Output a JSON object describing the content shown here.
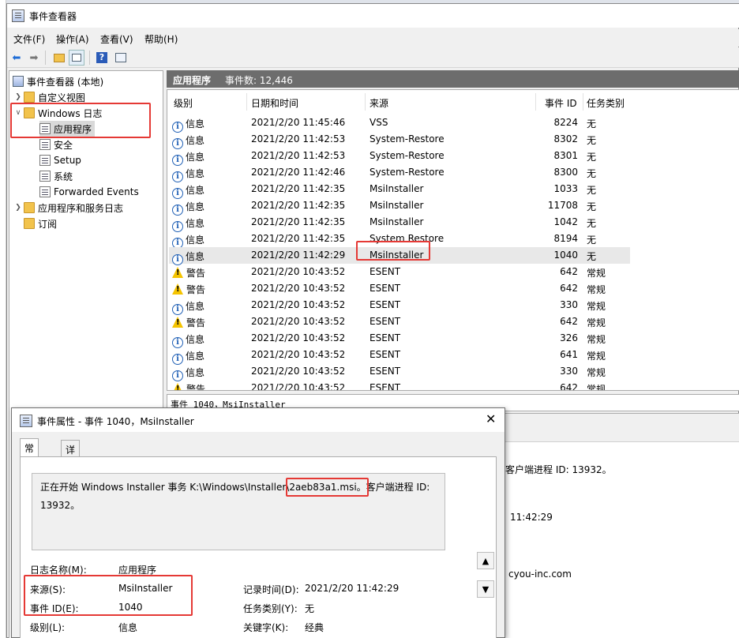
{
  "window": {
    "title": "事件查看器"
  },
  "menu": [
    "文件(F)",
    "操作(A)",
    "查看(V)",
    "帮助(H)"
  ],
  "toolbar_icons": [
    "back-arrow-icon",
    "forward-arrow-icon",
    "folder-up-icon",
    "show-hide-tree-icon",
    "help-icon",
    "properties-icon"
  ],
  "tree": {
    "root": "事件查看器 (本地)",
    "custom_views": "自定义视图",
    "windows_logs": "Windows 日志",
    "children": [
      "应用程序",
      "安全",
      "Setup",
      "系统",
      "Forwarded Events"
    ],
    "app_service_logs": "应用程序和服务日志",
    "subscriptions": "订阅"
  },
  "panel": {
    "title": "应用程序",
    "count": "事件数: 12,446"
  },
  "columns": [
    "级别",
    "日期和时间",
    "来源",
    "事件 ID",
    "任务类别"
  ],
  "rows": [
    {
      "level": "信息",
      "type": "info",
      "time": "2021/2/20 11:45:46",
      "source": "VSS",
      "id": "8224",
      "cat": "无"
    },
    {
      "level": "信息",
      "type": "info",
      "time": "2021/2/20 11:42:53",
      "source": "System-Restore",
      "id": "8302",
      "cat": "无"
    },
    {
      "level": "信息",
      "type": "info",
      "time": "2021/2/20 11:42:53",
      "source": "System-Restore",
      "id": "8301",
      "cat": "无"
    },
    {
      "level": "信息",
      "type": "info",
      "time": "2021/2/20 11:42:46",
      "source": "System-Restore",
      "id": "8300",
      "cat": "无"
    },
    {
      "level": "信息",
      "type": "info",
      "time": "2021/2/20 11:42:35",
      "source": "MsiInstaller",
      "id": "1033",
      "cat": "无"
    },
    {
      "level": "信息",
      "type": "info",
      "time": "2021/2/20 11:42:35",
      "source": "MsiInstaller",
      "id": "11708",
      "cat": "无"
    },
    {
      "level": "信息",
      "type": "info",
      "time": "2021/2/20 11:42:35",
      "source": "MsiInstaller",
      "id": "1042",
      "cat": "无"
    },
    {
      "level": "信息",
      "type": "info",
      "time": "2021/2/20 11:42:35",
      "source": "System Restore",
      "id": "8194",
      "cat": "无"
    },
    {
      "level": "信息",
      "type": "info",
      "time": "2021/2/20 11:42:29",
      "source": "MsiInstaller",
      "id": "1040",
      "cat": "无"
    },
    {
      "level": "警告",
      "type": "warn",
      "time": "2021/2/20 10:43:52",
      "source": "ESENT",
      "id": "642",
      "cat": "常规"
    },
    {
      "level": "警告",
      "type": "warn",
      "time": "2021/2/20 10:43:52",
      "source": "ESENT",
      "id": "642",
      "cat": "常规"
    },
    {
      "level": "信息",
      "type": "info",
      "time": "2021/2/20 10:43:52",
      "source": "ESENT",
      "id": "330",
      "cat": "常规"
    },
    {
      "level": "警告",
      "type": "warn",
      "time": "2021/2/20 10:43:52",
      "source": "ESENT",
      "id": "642",
      "cat": "常规"
    },
    {
      "level": "信息",
      "type": "info",
      "time": "2021/2/20 10:43:52",
      "source": "ESENT",
      "id": "326",
      "cat": "常规"
    },
    {
      "level": "信息",
      "type": "info",
      "time": "2021/2/20 10:43:52",
      "source": "ESENT",
      "id": "641",
      "cat": "常规"
    },
    {
      "level": "信息",
      "type": "info",
      "time": "2021/2/20 10:43:52",
      "source": "ESENT",
      "id": "330",
      "cat": "常规"
    },
    {
      "level": "警告",
      "type": "warn",
      "time": "2021/2/20 10:43:52",
      "source": "ESENT",
      "id": "642",
      "cat": "常规"
    }
  ],
  "status_line": "事件 1040，MsiInstaller",
  "lower_right": {
    "client_pid": "客户端进程 ID: 13932。",
    "time": "11:42:29",
    "email": "cyou-inc.com"
  },
  "dialog": {
    "title": "事件属性 - 事件 1040，MsiInstaller",
    "tabs": [
      "常规",
      "详细信息"
    ],
    "desc_part1": "正在开始 Windows Installer 事务 K:\\Windows\\Installer\\",
    "desc_highlight": "2aeb83a1.msi。",
    "desc_part2": "客户端进程 ID:",
    "desc_line2": "13932。",
    "log_name_label": "日志名称(M):",
    "log_name_value": "应用程序",
    "source_label": "来源(S):",
    "source_value": "MsiInstaller",
    "recorded_label": "记录时间(D):",
    "recorded_value": "2021/2/20 11:42:29",
    "event_id_label": "事件 ID(E):",
    "event_id_value": "1040",
    "task_cat_label": "任务类别(Y):",
    "task_cat_value": "无",
    "level_label": "级别(L):",
    "level_value": "信息",
    "keywords_label": "关键字(K):",
    "keywords_value": "经典"
  },
  "colors": {
    "annotation": "#e53935",
    "header_bg": "#6d6d6d",
    "info_blue": "#1f5fb5",
    "warn_yellow": "#f5c400"
  }
}
